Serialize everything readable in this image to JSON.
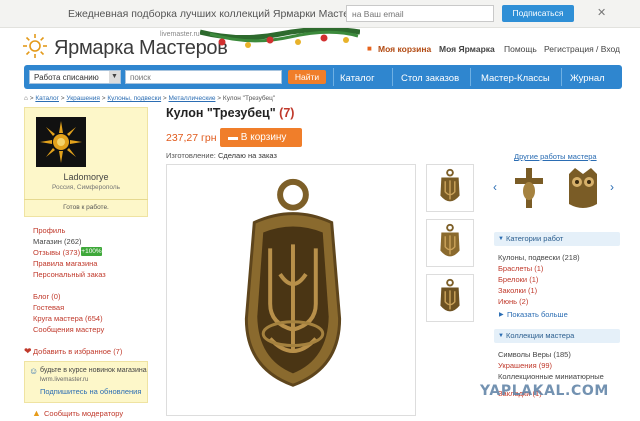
{
  "promo": {
    "text": "Ежедневная подборка лучших коллекций Ярмарки Мастеров",
    "email_placeholder": "на Ваш email",
    "subscribe": "Подписаться",
    "close": "✕"
  },
  "header": {
    "logo": "Ярмарка Мастеров",
    "logo_sub": "livemaster.ru",
    "cart": "Моя корзина",
    "my_work": "Моя Ярмарка",
    "help": "Помощь",
    "register": "Регистрация / Вход"
  },
  "nav": {
    "sort_select": "Работа списанию",
    "search_placeholder": "поиск",
    "find": "Найти",
    "items": [
      "Каталог",
      "Стол заказов",
      "Мастер-Классы",
      "Журнал"
    ]
  },
  "breadcrumbs": [
    "Каталог",
    "Украшения",
    "Кулоны, подвески",
    "Металлические",
    "Кулон \"Трезубец\""
  ],
  "shop": {
    "name": "Ladomorye",
    "location": "Россия, Симферополь",
    "ready": "Готов к работе."
  },
  "left_menu": {
    "profile": "Профиль",
    "shop_label": "Магазин",
    "shop_count": "(262)",
    "reviews_label": "Отзывы",
    "reviews_count": "(373)",
    "reviews_badge": "+100%",
    "rules": "Правила магазина",
    "personal_order": "Персональный заказ",
    "blog": "Блог (0)",
    "guestbook": "Гостевая",
    "circle": "Круга мастера (654)",
    "message": "Сообщения мастеру",
    "favorite": "Добавить в избранное (7)"
  },
  "subscribe_box": {
    "line1": "будьте в курсе новинок магазина",
    "line2": "lwrm.livemaster.ru",
    "line3": "Подпишитесь на обновления"
  },
  "report": "Сообщить модератору",
  "product": {
    "title": "Кулон \"Трезубец\"",
    "count": "(7)",
    "price": "237,27 грн",
    "cart_button": "В корзину",
    "made_label": "Изготовление:",
    "made_value": "Сделаю на заказ"
  },
  "right": {
    "other_title": "Другие работы мастера",
    "categories_head": "Категории работ",
    "categories": [
      "Кулоны, подвески (218)",
      "Браслеты (1)",
      "Брелоки (1)",
      "Заколки (1)",
      "Июнь (2)"
    ],
    "show_more": "Показать больше",
    "collections_head": "Коллекции мастера",
    "collections": [
      "Символы Веры (185)",
      "Украшения (99)",
      "Коллекционные миниатюрные",
      "Закладки (1)"
    ]
  },
  "watermark": "YAPLAKAL.COM",
  "colors": {
    "brand_blue": "#2f86cf",
    "accent_orange": "#f07e2a",
    "link_red": "#c0392b",
    "bronze": "#8a6a2e"
  },
  "icons": [
    "sun-logo-icon",
    "cart-icon",
    "heart-icon",
    "person-icon",
    "alert-icon",
    "chevron-left-icon",
    "chevron-right-icon",
    "triangle-down-icon"
  ]
}
